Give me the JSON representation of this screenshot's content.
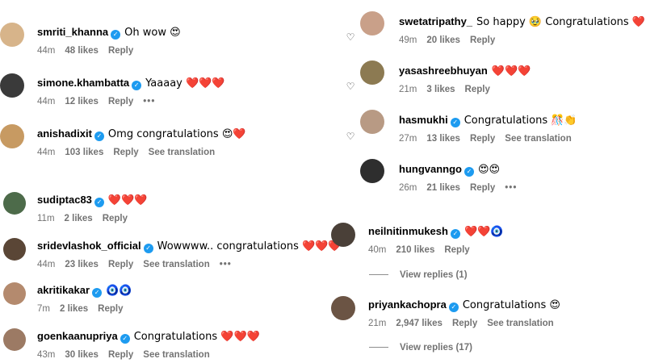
{
  "left_column": [
    {
      "username": "smriti_khanna",
      "verified": true,
      "text": "Oh wow 😍",
      "time": "44m",
      "likes": "48 likes",
      "reply": "Reply",
      "translation": "",
      "more": "",
      "avatar_color": "#d7b48a"
    },
    {
      "username": "simone.khambatta",
      "verified": true,
      "text": "Yaaaay ❤️❤️❤️",
      "time": "44m",
      "likes": "12 likes",
      "reply": "Reply",
      "translation": "",
      "more": "•••",
      "avatar_color": "#3a3a3a"
    },
    {
      "username": "anishadixit",
      "verified": true,
      "text": "Omg congratulations 😍❤️",
      "time": "44m",
      "likes": "103 likes",
      "reply": "Reply",
      "translation": "See translation",
      "more": "",
      "avatar_color": "#c79a62"
    },
    {
      "username": "sudiptac83",
      "verified": true,
      "text": "❤️❤️❤️",
      "time": "11m",
      "likes": "2 likes",
      "reply": "Reply",
      "translation": "",
      "more": "",
      "avatar_color": "#4d6b4a"
    },
    {
      "username": "sridevlashok_official",
      "verified": true,
      "text": "Wowwww.. congratulations ❤️❤️❤️",
      "time": "44m",
      "likes": "23 likes",
      "reply": "Reply",
      "translation": "See translation",
      "more": "•••",
      "avatar_color": "#5a4636"
    },
    {
      "username": "akritikakar",
      "verified": true,
      "text": "🧿🧿",
      "time": "7m",
      "likes": "2 likes",
      "reply": "Reply",
      "translation": "",
      "more": "",
      "avatar_color": "#b48a6e"
    },
    {
      "username": "goenkaanupriya",
      "verified": true,
      "text": "Congratulations ❤️❤️❤️",
      "time": "43m",
      "likes": "30 likes",
      "reply": "Reply",
      "translation": "See translation",
      "more": "",
      "avatar_color": "#9c7a64"
    }
  ],
  "right_column": [
    {
      "username": "swetatripathy_",
      "verified": false,
      "text": "So happy 🥹 Congratulations ❤️🙌",
      "time": "49m",
      "likes": "20 likes",
      "reply": "Reply",
      "translation": "",
      "more": "",
      "avatar_color": "#c9a089"
    },
    {
      "username": "yasashreebhuyan",
      "verified": false,
      "text": "❤️❤️❤️",
      "time": "21m",
      "likes": "3 likes",
      "reply": "Reply",
      "translation": "",
      "more": "",
      "avatar_color": "#8c7a52"
    },
    {
      "username": "hasmukhi",
      "verified": true,
      "text": "Congratulations 🎊👏",
      "time": "27m",
      "likes": "13 likes",
      "reply": "Reply",
      "translation": "See translation",
      "more": "",
      "avatar_color": "#b89a84"
    },
    {
      "username": "hungvanngo",
      "verified": true,
      "text": "😍😍",
      "time": "26m",
      "likes": "21 likes",
      "reply": "Reply",
      "translation": "",
      "more": "•••",
      "avatar_color": "#2e2e2e"
    },
    {
      "username": "neilnitinmukesh",
      "verified": true,
      "text": "❤️❤️🧿",
      "time": "40m",
      "likes": "210 likes",
      "reply": "Reply",
      "translation": "",
      "more": "",
      "avatar_color": "#4a4038"
    },
    {
      "username": "priyankachopra",
      "verified": true,
      "text": "Congratulations 😍",
      "time": "21m",
      "likes": "2,947 likes",
      "reply": "Reply",
      "translation": "See translation",
      "more": "",
      "avatar_color": "#6b5444"
    }
  ],
  "view_replies": [
    {
      "label": "View replies (1)"
    },
    {
      "label": "View replies (17)"
    }
  ],
  "icons": {
    "verified": "✓",
    "heart": "♡"
  },
  "colors": {
    "verified_blue": "#1d9bf0",
    "meta_gray": "#737373"
  }
}
